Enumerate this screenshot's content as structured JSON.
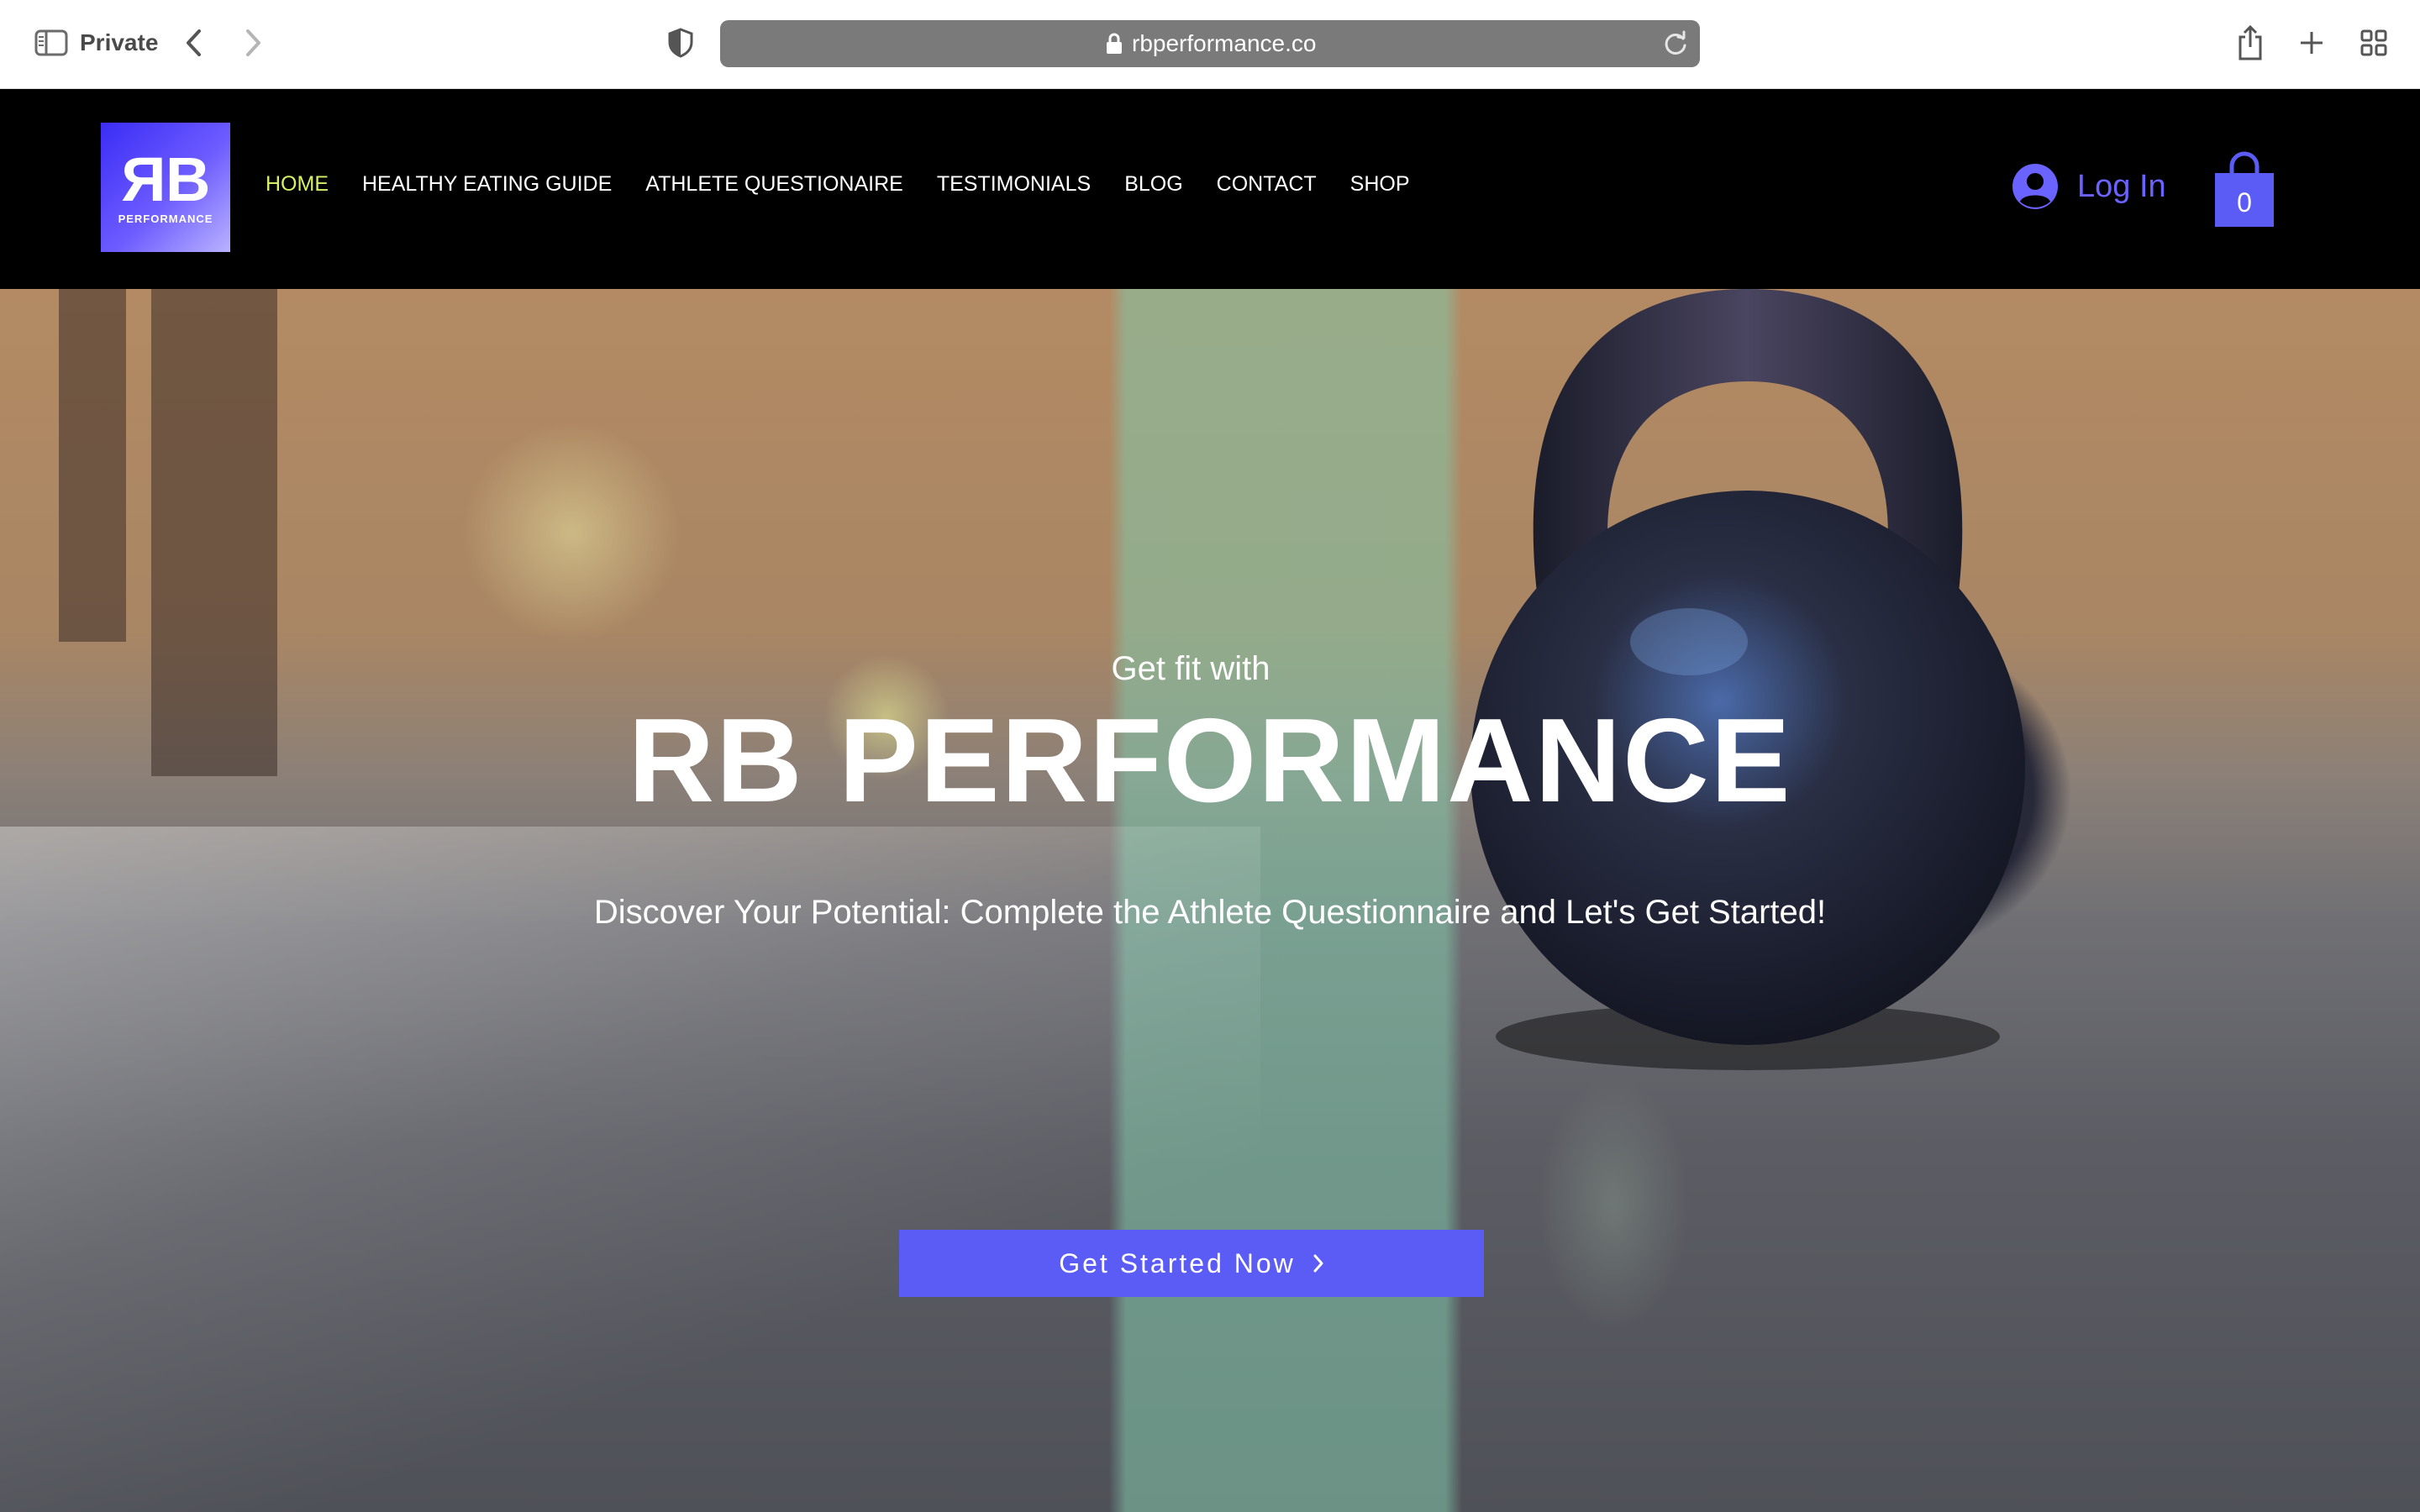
{
  "browser": {
    "private_label": "Private",
    "url": "rbperformance.co"
  },
  "site": {
    "logo": {
      "monogram_r": "R",
      "monogram_b": "B",
      "subtitle": "PERFORMANCE",
      "gradient_colors": [
        "#3b2df5",
        "#6d5cff",
        "#b9b2ff"
      ]
    },
    "nav": [
      {
        "label": "HOME",
        "active": true
      },
      {
        "label": "HEALTHY EATING GUIDE",
        "active": false
      },
      {
        "label": "ATHLETE QUESTIONAIRE",
        "active": false
      },
      {
        "label": "TESTIMONIALS",
        "active": false
      },
      {
        "label": "BLOG",
        "active": false
      },
      {
        "label": "CONTACT",
        "active": false
      },
      {
        "label": "SHOP",
        "active": false
      }
    ],
    "login_label": "Log In",
    "cart_count": "0",
    "colors": {
      "accent": "#5a5cf5",
      "nav_active": "#d6f06a",
      "login": "#6a63ff",
      "header_bg": "#000000"
    }
  },
  "hero": {
    "pretitle": "Get fit with",
    "title": "RB PERFORMANCE",
    "subtitle": "Discover Your Potential: Complete the Athlete Questionnaire and Let's Get Started!",
    "cta_label": "Get Started Now"
  }
}
